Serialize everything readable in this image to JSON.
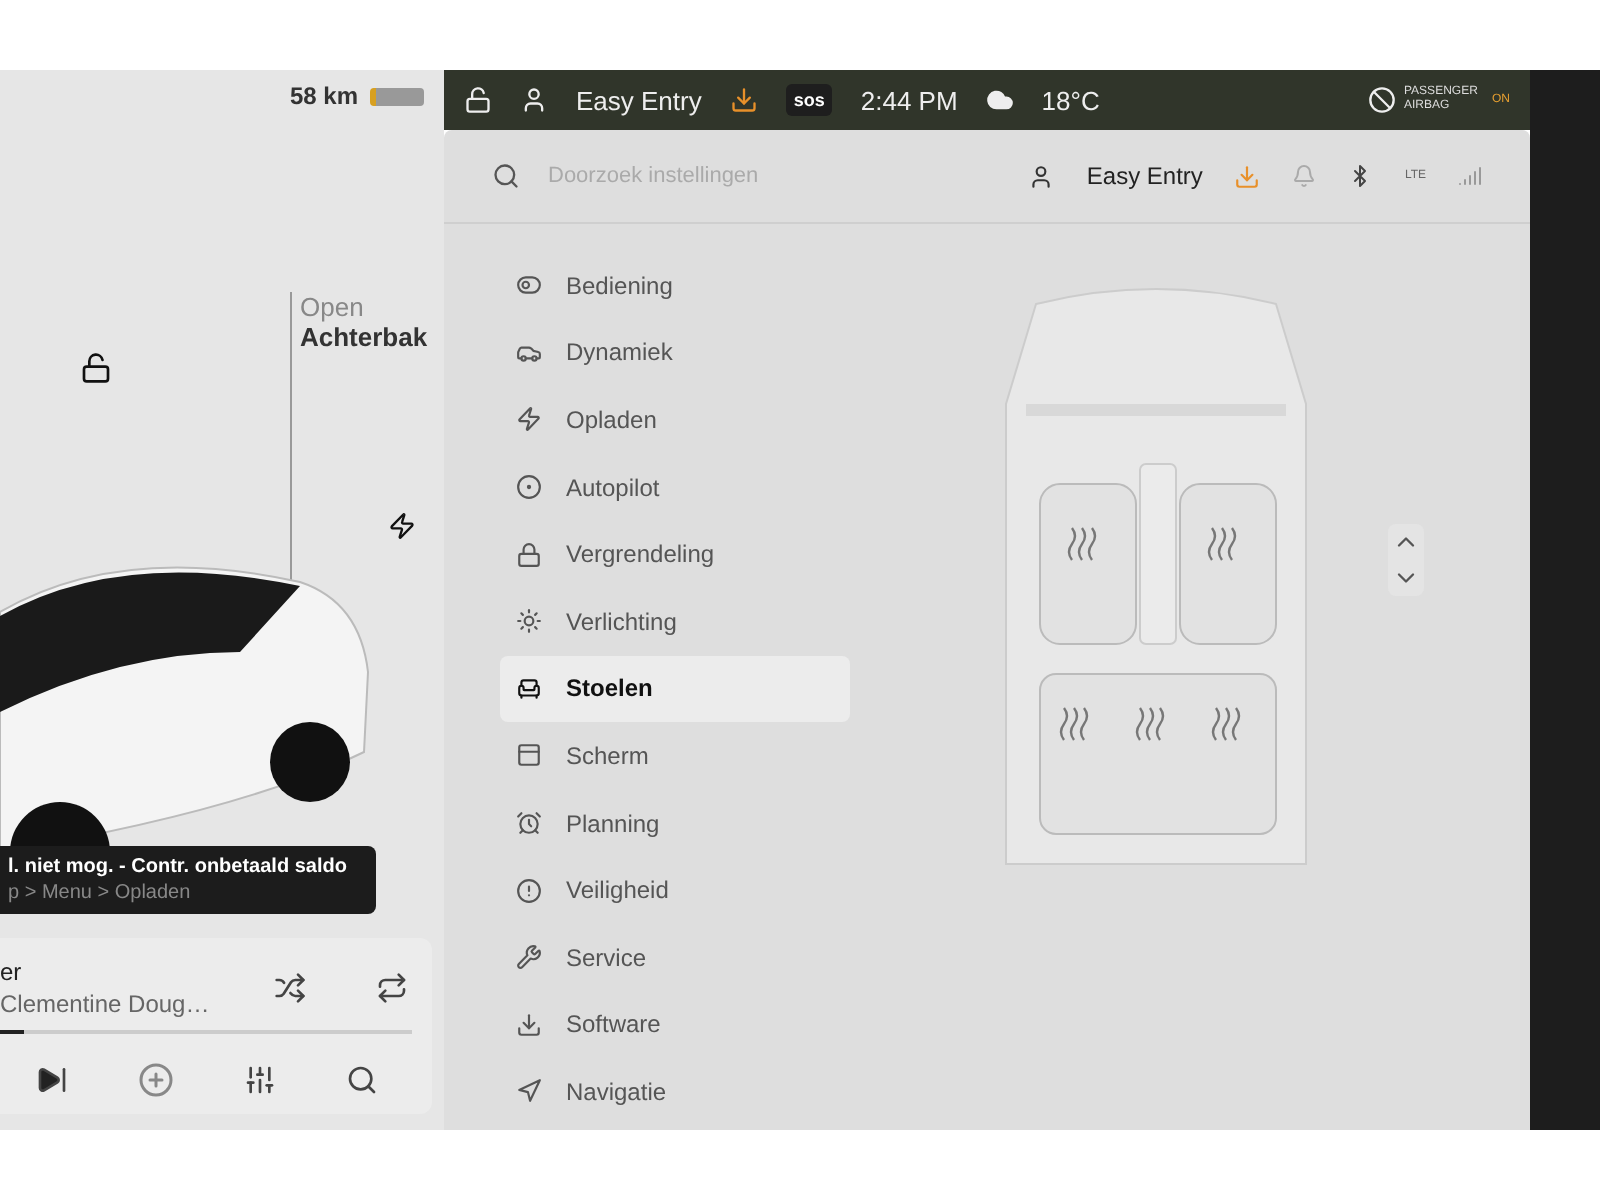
{
  "status": {
    "range": "58 km"
  },
  "car_panel": {
    "trunk_state": "Open",
    "trunk_name": "Achterbak"
  },
  "notification": {
    "title": "l. niet mog. - Contr. onbetaald saldo",
    "path": "p > Menu > Opladen"
  },
  "media": {
    "title": "er",
    "artist": "Clementine Doug…",
    "progress": {
      "level": 0.06
    }
  },
  "top_bar": {
    "profile": "Easy Entry",
    "sos": "sos",
    "time": "2:44 PM",
    "temperature": "18°C",
    "airbag_label": "PASSENGER AIRBAG",
    "airbag_state": "ON"
  },
  "search": {
    "placeholder": "Doorzoek instellingen"
  },
  "header": {
    "profile": "Easy Entry",
    "network": "LTE"
  },
  "menu": [
    {
      "label": "Bediening",
      "selected": false
    },
    {
      "label": "Dynamiek",
      "selected": false
    },
    {
      "label": "Opladen",
      "selected": false
    },
    {
      "label": "Autopilot",
      "selected": false
    },
    {
      "label": "Vergrendeling",
      "selected": false
    },
    {
      "label": "Verlichting",
      "selected": false
    },
    {
      "label": "Stoelen",
      "selected": true
    },
    {
      "label": "Scherm",
      "selected": false
    },
    {
      "label": "Planning",
      "selected": false
    },
    {
      "label": "Veiligheid",
      "selected": false
    },
    {
      "label": "Service",
      "selected": false
    },
    {
      "label": "Software",
      "selected": false
    },
    {
      "label": "Navigatie",
      "selected": false
    }
  ]
}
